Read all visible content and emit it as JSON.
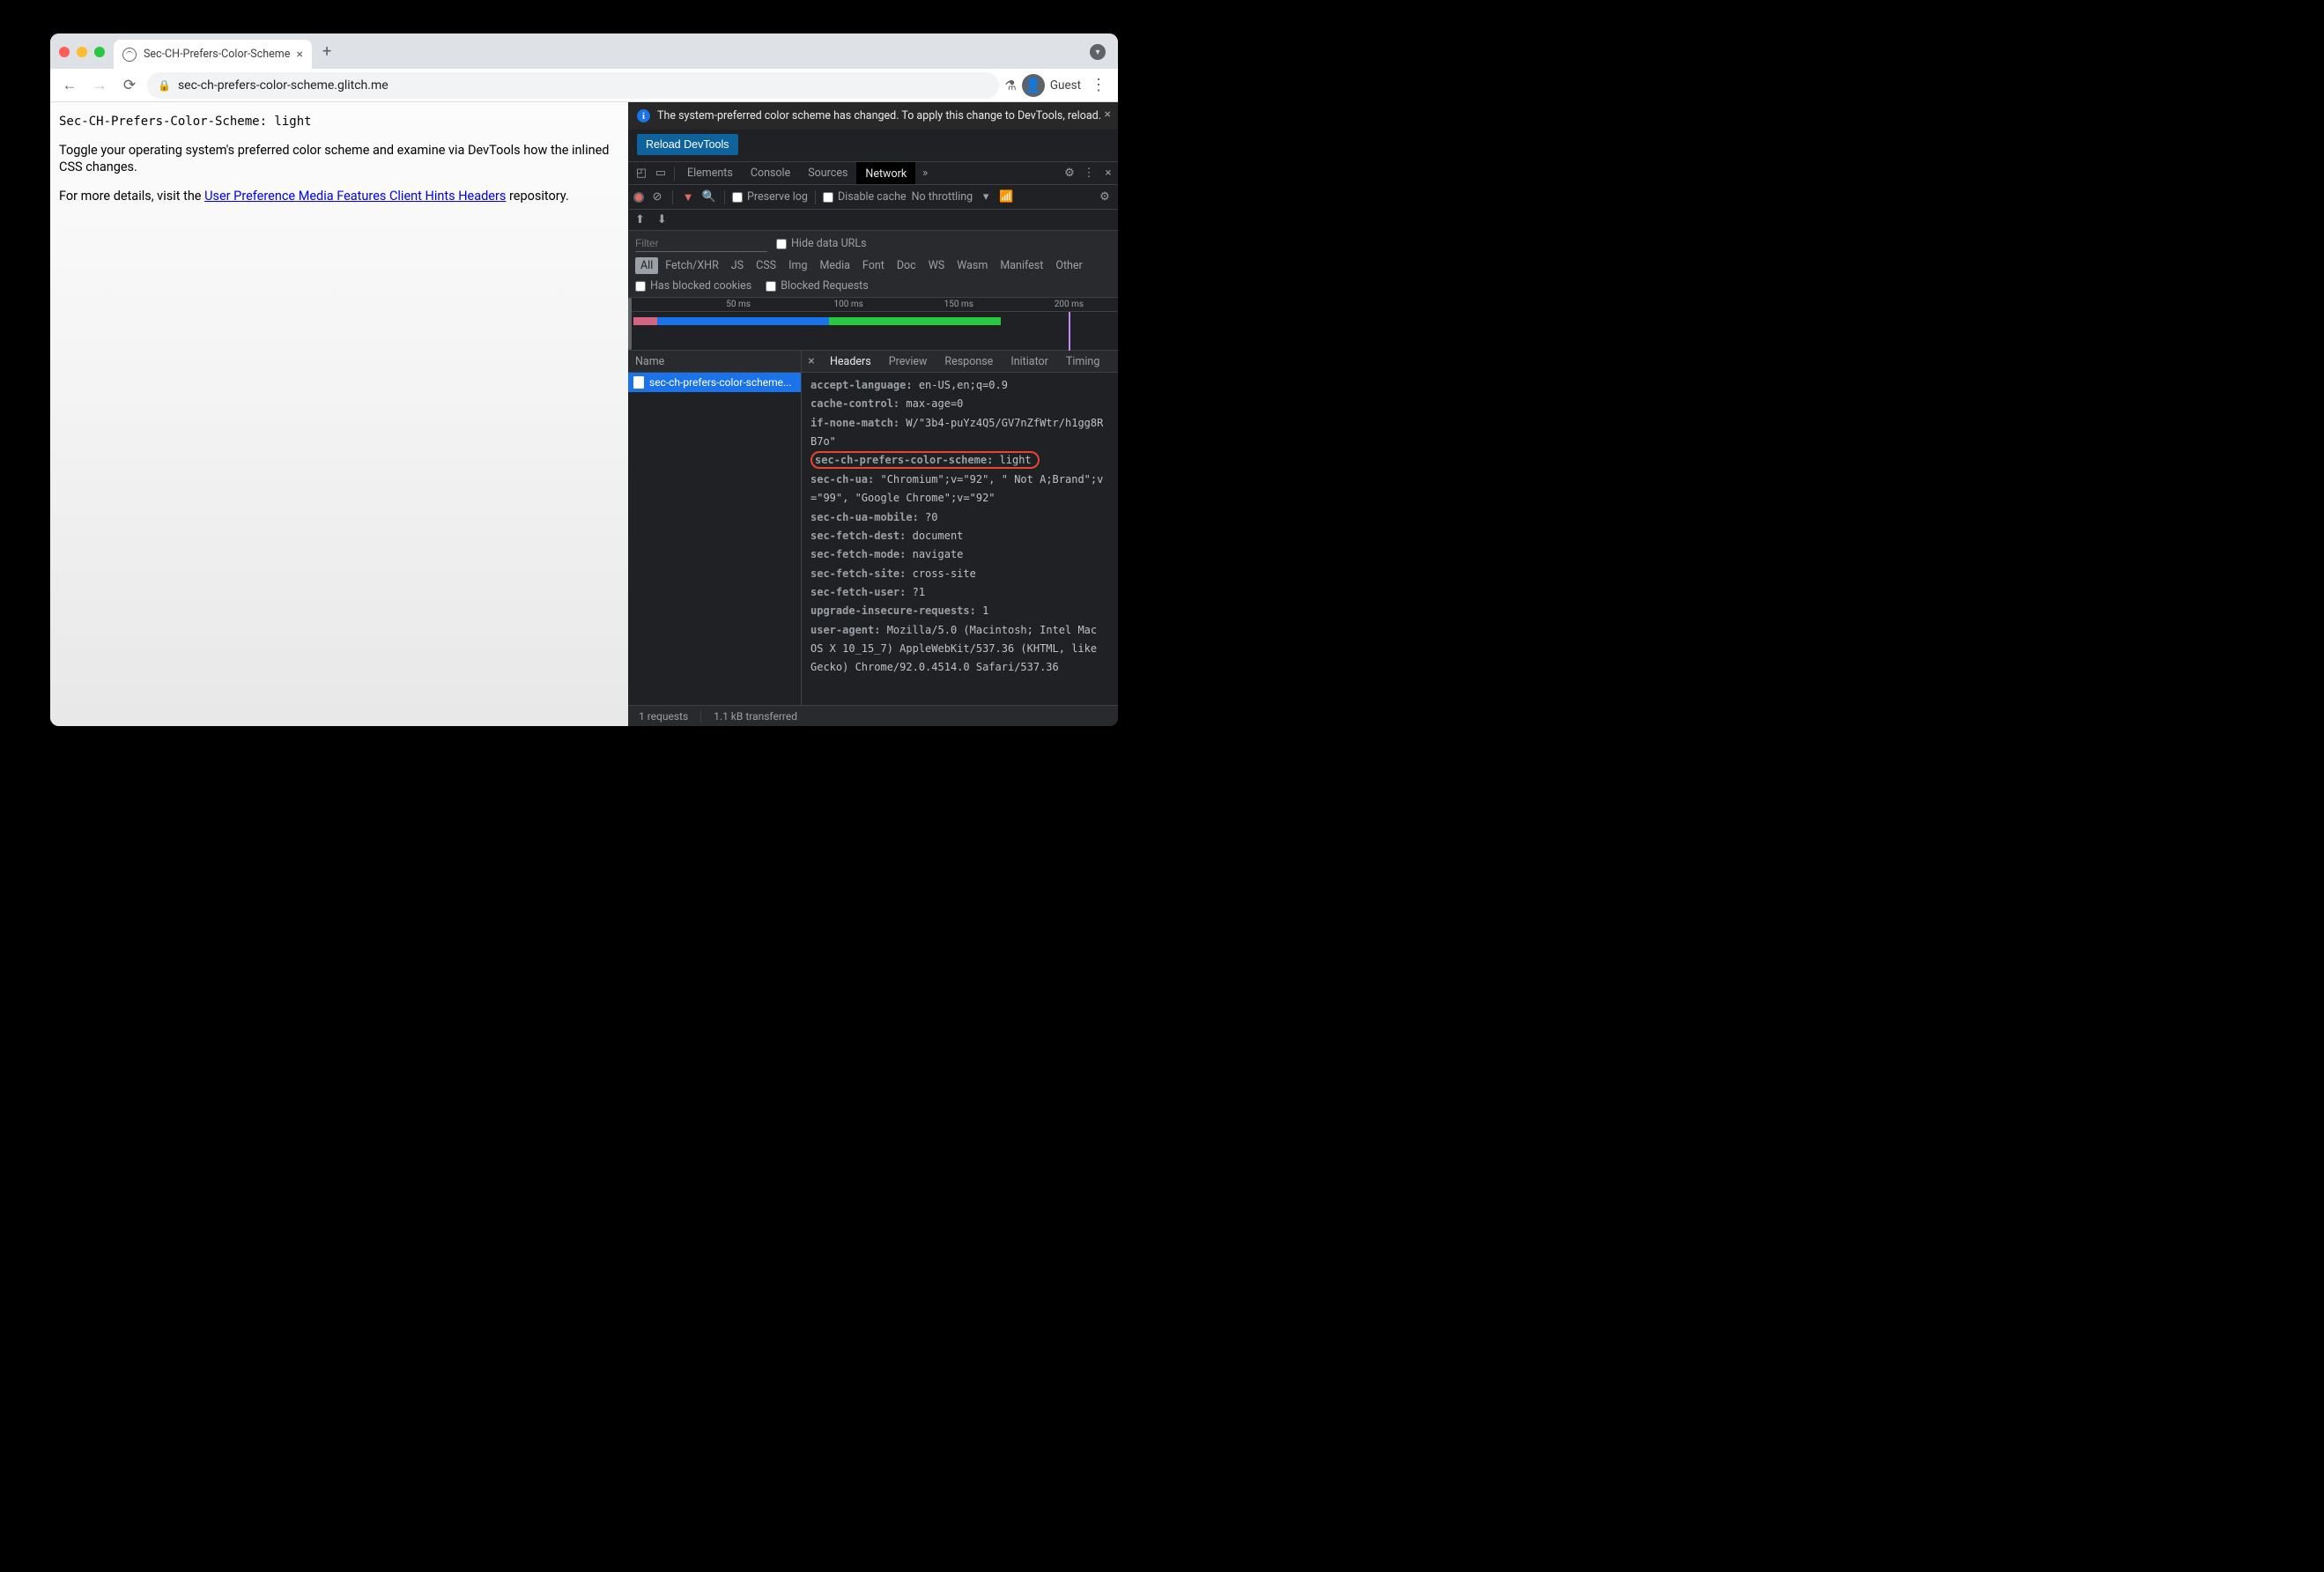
{
  "tab": {
    "title": "Sec-CH-Prefers-Color-Scheme"
  },
  "toolbar": {
    "url_domain": "sec-ch-prefers-color-scheme.glitch.me",
    "guest_label": "Guest"
  },
  "page": {
    "mono": "Sec-CH-Prefers-Color-Scheme: light",
    "p1": "Toggle your operating system's preferred color scheme and examine via DevTools how the inlined CSS changes.",
    "p2a": "For more details, visit the ",
    "p2_link": "User Preference Media Features Client Hints Headers",
    "p2b": " repository."
  },
  "devtools": {
    "banner_text": "The system-preferred color scheme has changed. To apply this change to DevTools, reload.",
    "reload_label": "Reload DevTools",
    "tabs": [
      "Elements",
      "Console",
      "Sources",
      "Network"
    ],
    "active_tab": "Network",
    "net": {
      "preserve": "Preserve log",
      "disable": "Disable cache",
      "throttle": "No throttling",
      "filter_placeholder": "Filter",
      "hide_urls": "Hide data URLs",
      "types": [
        "All",
        "Fetch/XHR",
        "JS",
        "CSS",
        "Img",
        "Media",
        "Font",
        "Doc",
        "WS",
        "Wasm",
        "Manifest",
        "Other"
      ],
      "blocked_cookies": "Has blocked cookies",
      "blocked_reqs": "Blocked Requests",
      "ruler": [
        "50 ms",
        "100 ms",
        "150 ms",
        "200 ms"
      ],
      "name_header": "Name",
      "request_name": "sec-ch-prefers-color-scheme...",
      "detail_tabs": [
        "Headers",
        "Preview",
        "Response",
        "Initiator",
        "Timing"
      ],
      "headers": [
        {
          "k": "accept-language:",
          "v": " en-US,en;q=0.9"
        },
        {
          "k": "cache-control:",
          "v": " max-age=0"
        },
        {
          "k": "if-none-match:",
          "v": " W/\"3b4-puYz4Q5/GV7nZfWtr/h1gg8RB7o\""
        },
        {
          "k": "sec-ch-prefers-color-scheme:",
          "v": " light",
          "highlight": true
        },
        {
          "k": "sec-ch-ua:",
          "v": " \"Chromium\";v=\"92\", \" Not A;Brand\";v=\"99\", \"Google Chrome\";v=\"92\""
        },
        {
          "k": "sec-ch-ua-mobile:",
          "v": " ?0"
        },
        {
          "k": "sec-fetch-dest:",
          "v": " document"
        },
        {
          "k": "sec-fetch-mode:",
          "v": " navigate"
        },
        {
          "k": "sec-fetch-site:",
          "v": " cross-site"
        },
        {
          "k": "sec-fetch-user:",
          "v": " ?1"
        },
        {
          "k": "upgrade-insecure-requests:",
          "v": " 1"
        },
        {
          "k": "user-agent:",
          "v": " Mozilla/5.0 (Macintosh; Intel Mac OS X 10_15_7) AppleWebKit/537.36 (KHTML, like Gecko) Chrome/92.0.4514.0 Safari/537.36"
        }
      ],
      "status": {
        "reqs": "1 requests",
        "xfer": "1.1 kB transferred"
      }
    }
  }
}
